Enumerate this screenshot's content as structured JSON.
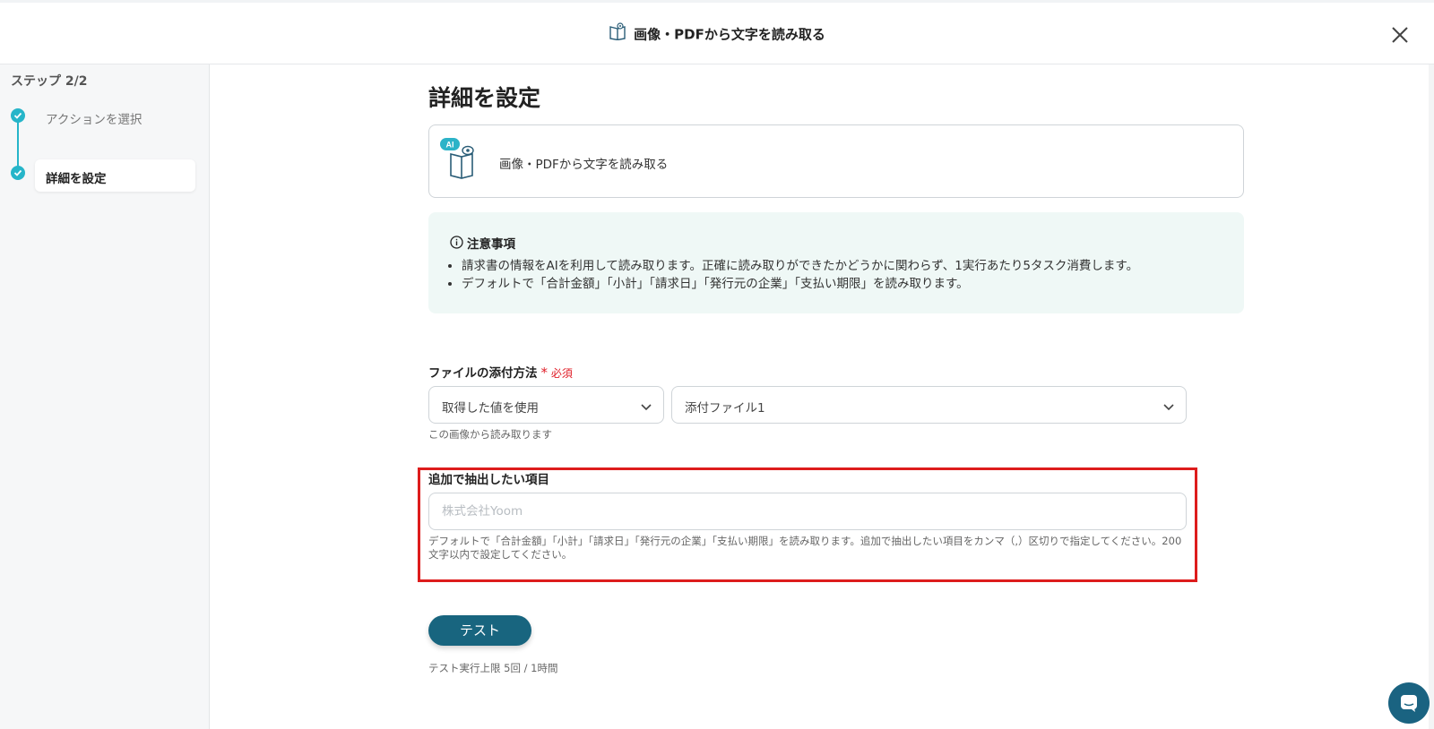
{
  "header": {
    "title": "画像・PDFから文字を読み取る"
  },
  "sidebar": {
    "step_header": "ステップ 2/2",
    "steps": [
      {
        "label": "アクションを選択",
        "done": true
      },
      {
        "label": "詳細を設定",
        "done": true,
        "active": true
      }
    ],
    "accent_color": "#26b5c9"
  },
  "main": {
    "page_title": "詳細を設定",
    "action_card": {
      "badge": "AI",
      "label": "画像・PDFから文字を読み取る"
    },
    "notice": {
      "title": "注意事項",
      "items": [
        "請求書の情報をAIを利用して読み取ります。正確に読み取りができたかどうかに関わらず、1実行あたり5タスク消費します。",
        "デフォルトで「合計金額」「小計」「請求日」「発行元の企業」「支払い期限」を読み取ります。"
      ]
    },
    "attach_field": {
      "label": "ファイルの添付方法",
      "required_mark": "*",
      "required_text": "必須",
      "method_value": "取得した値を使用",
      "file_value": "添付ファイル1",
      "hint": "この画像から読み取ります"
    },
    "extra_field": {
      "label": "追加で抽出したい項目",
      "placeholder": "株式会社Yoom",
      "value": "",
      "hint": "デフォルトで「合計金額」「小計」「請求日」「発行元の企業」「支払い期限」を読み取ります。追加で抽出したい項目をカンマ（,）区切りで指定してください。200文字以内で設定してください。"
    },
    "test_button": "テスト",
    "test_limit": "テスト実行上限 5回 / 1時間"
  },
  "colors": {
    "primary": "#18657f",
    "highlight": "#dd1c1c",
    "required": "#e0202a",
    "notice_bg": "#eff8f6"
  }
}
